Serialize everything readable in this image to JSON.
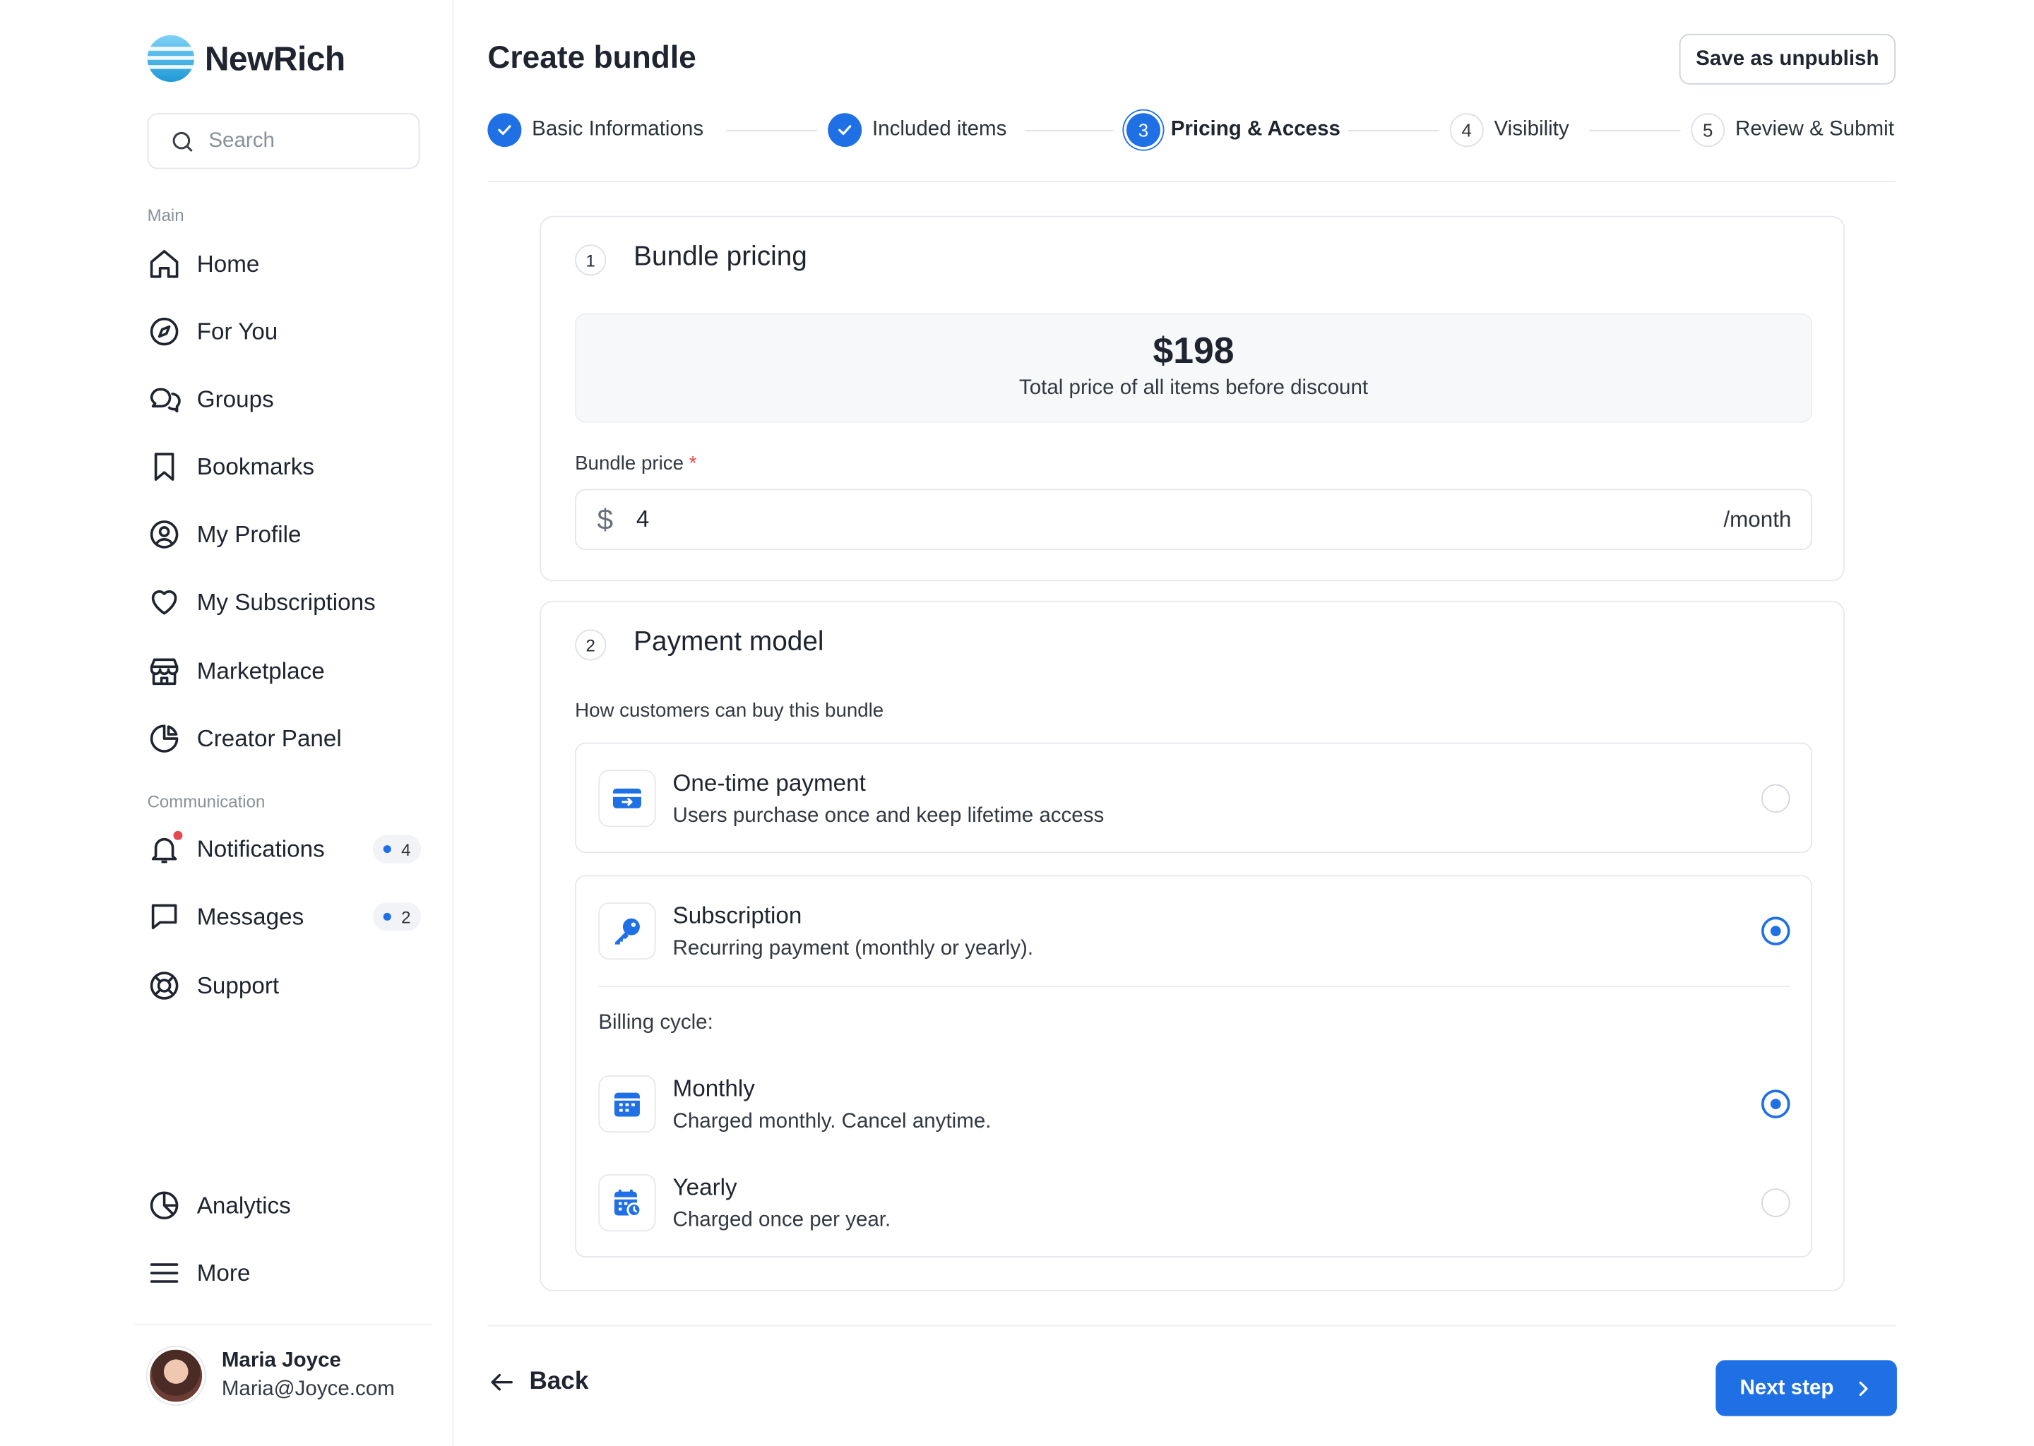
{
  "app": {
    "name": "NewRich"
  },
  "search": {
    "placeholder": "Search"
  },
  "sidebar": {
    "main_label": "Main",
    "main_items": [
      {
        "label": "Home",
        "icon": "home-icon"
      },
      {
        "label": "For You",
        "icon": "compass-icon"
      },
      {
        "label": "Groups",
        "icon": "chat-bubbles-icon"
      },
      {
        "label": "Bookmarks",
        "icon": "bookmark-icon"
      },
      {
        "label": "My Profile",
        "icon": "user-circle-icon"
      },
      {
        "label": "My Subscriptions",
        "icon": "heart-icon"
      },
      {
        "label": "Marketplace",
        "icon": "store-icon"
      },
      {
        "label": "Creator Panel",
        "icon": "pie-chart-icon"
      }
    ],
    "comm_label": "Communication",
    "comm_items": [
      {
        "label": "Notifications",
        "icon": "bell-icon",
        "badge": "4"
      },
      {
        "label": "Messages",
        "icon": "message-icon",
        "badge": "2"
      },
      {
        "label": "Support",
        "icon": "lifebuoy-icon"
      }
    ],
    "bottom_items": [
      {
        "label": "Analytics",
        "icon": "analytics-icon"
      },
      {
        "label": "More",
        "icon": "menu-icon"
      }
    ]
  },
  "user": {
    "name": "Maria Joyce",
    "email": "Maria@Joyce.com"
  },
  "header": {
    "title": "Create bundle",
    "save_label": "Save as unpublish"
  },
  "steps": [
    {
      "num": "1",
      "label": "Basic Informations",
      "state": "done"
    },
    {
      "num": "2",
      "label": "Included items",
      "state": "done"
    },
    {
      "num": "3",
      "label": "Pricing & Access",
      "state": "current"
    },
    {
      "num": "4",
      "label": "Visibility",
      "state": "todo"
    },
    {
      "num": "5",
      "label": "Review & Submit",
      "state": "todo"
    }
  ],
  "pricing": {
    "num": "1",
    "title": "Bundle pricing",
    "total": "$198",
    "total_caption": "Total price of all items before discount",
    "field_label": "Bundle price",
    "required_mark": "*",
    "currency": "$",
    "value": "4",
    "unit": "/month"
  },
  "payment": {
    "num": "2",
    "title": "Payment model",
    "subtitle": "How customers can buy this bundle",
    "options": [
      {
        "title": "One-time payment",
        "desc": "Users purchase once and keep lifetime access",
        "selected": false,
        "icon": "credit-card-icon"
      },
      {
        "title": "Subscription",
        "desc": "Recurring payment (monthly or yearly).",
        "selected": true,
        "icon": "key-icon"
      }
    ],
    "billing_label": "Billing cycle:",
    "billing": [
      {
        "title": "Monthly",
        "desc": "Charged monthly. Cancel anytime.",
        "selected": true,
        "icon": "calendar-icon"
      },
      {
        "title": "Yearly",
        "desc": "Charged once per year.",
        "selected": false,
        "icon": "calendar-clock-icon"
      }
    ]
  },
  "footer": {
    "back_label": "Back",
    "next_label": "Next step"
  },
  "colors": {
    "accent": "#1f6fe5",
    "notification": "#e5484d",
    "text": "#1f2430",
    "border": "#e6e8ec"
  }
}
